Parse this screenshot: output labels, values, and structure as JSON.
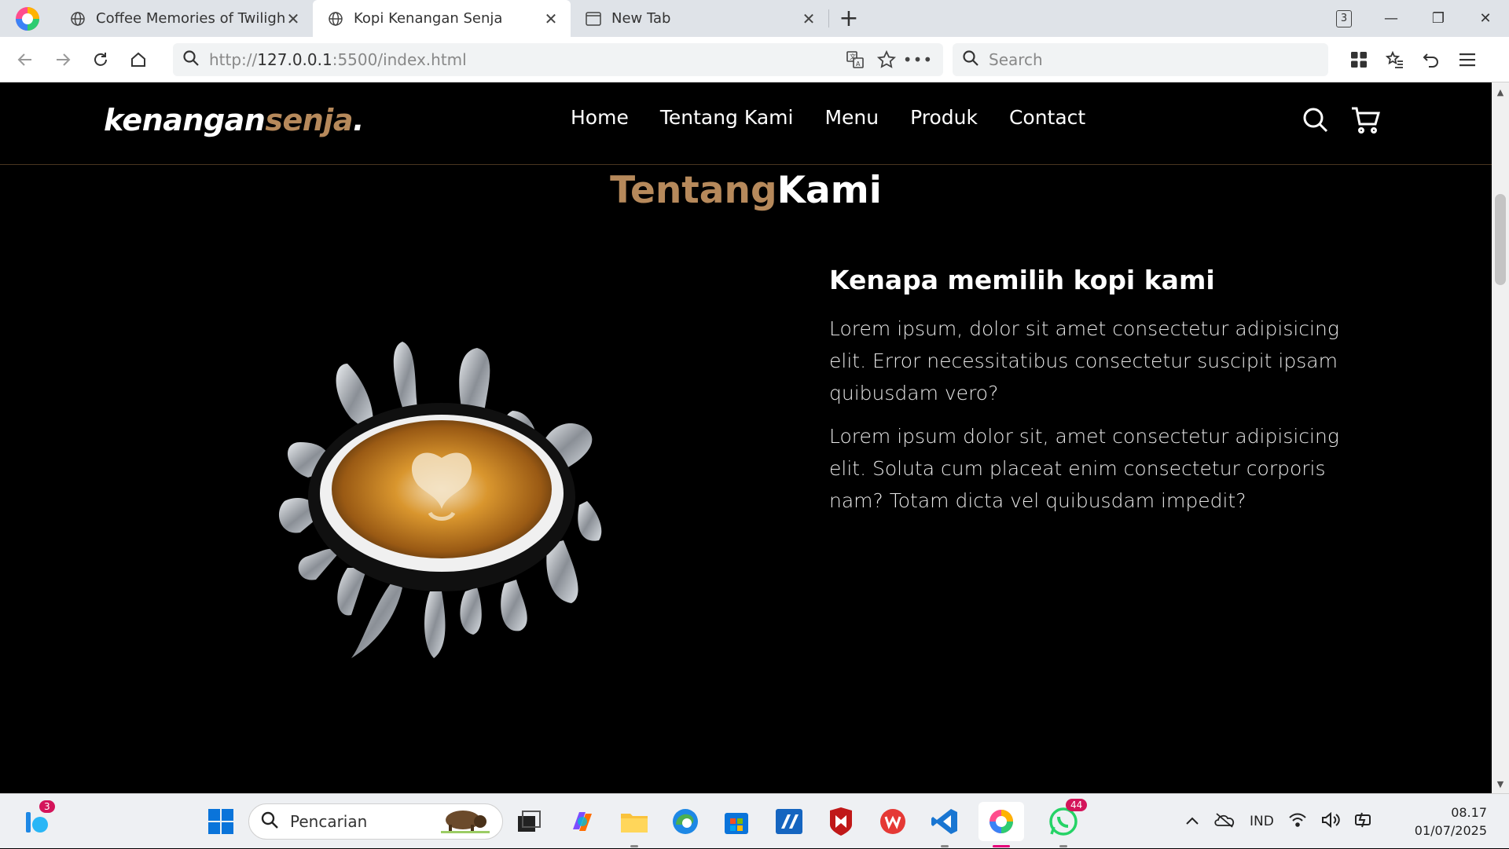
{
  "browser": {
    "tabs": [
      {
        "title": "Coffee Memories of Twilight",
        "active": false
      },
      {
        "title": "Kopi Kenangan Senja",
        "active": true
      },
      {
        "title": "New Tab",
        "active": false
      }
    ],
    "tab_count": "3",
    "url_prefix": "http://",
    "url_host": "127.0.0.1",
    "url_rest": ":5500/index.html",
    "search_placeholder": "Search"
  },
  "site": {
    "logo_main": "kenangan",
    "logo_accent": "senja",
    "logo_dot": ".",
    "nav": [
      "Home",
      "Tentang Kami",
      "Menu",
      "Produk",
      "Contact"
    ],
    "section_title_part1": "Tentang",
    "section_title_part2": "Kami",
    "heading": "Kenapa memilih kopi kami",
    "paragraph1": "Lorem ipsum, dolor sit amet consectetur adipisicing elit. Error necessitatibus consectetur suscipit ipsam quibusdam vero?",
    "paragraph2": "Lorem ipsum dolor sit, amet consectetur adipisicing elit. Soluta cum placeat enim consectetur corporis nam? Totam dicta vel quibusdam impedit?",
    "accent_color": "#b6895b"
  },
  "taskbar": {
    "search_label": "Pencarian",
    "widget_badge": "3",
    "whatsapp_badge": "44",
    "language": "IND",
    "time": "08.17",
    "date": "01/07/2025"
  }
}
